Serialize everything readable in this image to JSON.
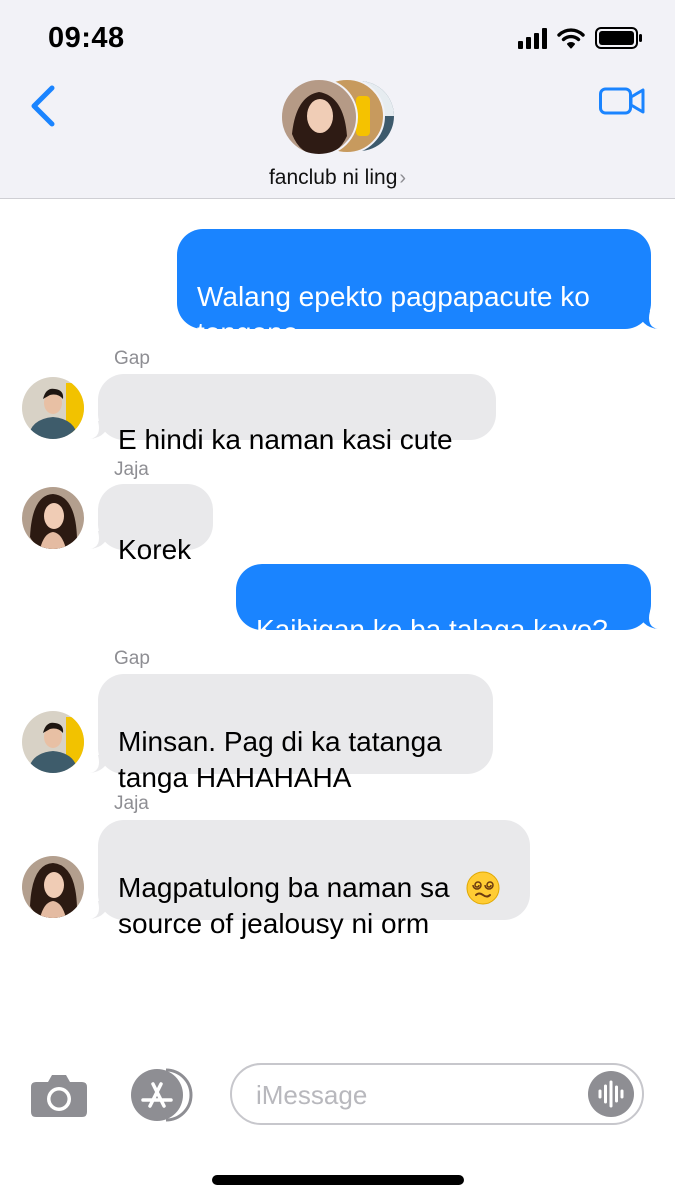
{
  "status_bar": {
    "time": "09:48",
    "signal_icon": "signal-bars-icon",
    "wifi_icon": "wifi-icon",
    "battery_icon": "battery-full-icon"
  },
  "header": {
    "back_icon": "chevron-left-icon",
    "group_name": "fanclub ni ling",
    "group_chevron": "›",
    "video_icon": "video-camera-icon",
    "accent_color": "#1a84ff"
  },
  "messages": [
    {
      "direction": "outgoing",
      "text": "Walang epekto pagpapacute ko\ntengene"
    },
    {
      "direction": "incoming",
      "sender": "Gap",
      "text": "E hindi ka naman kasi cute"
    },
    {
      "direction": "incoming",
      "sender": "Jaja",
      "text": "Korek"
    },
    {
      "direction": "outgoing",
      "text": "Kaibigan ko ba talaga kayo?"
    },
    {
      "direction": "incoming",
      "sender": "Gap",
      "text": "Minsan. Pag di ka tatanga\ntanga HAHAHAHA"
    },
    {
      "direction": "incoming",
      "sender": "Jaja",
      "text": "Magpatulong ba naman sa\nsource of jealousy ni orm",
      "trailing_emoji": "face-with-spiral-eyes-emoji"
    }
  ],
  "input": {
    "placeholder": "iMessage",
    "camera_icon": "camera-icon",
    "apps_icon": "app-store-icon",
    "audio_icon": "audio-waveform-icon"
  }
}
